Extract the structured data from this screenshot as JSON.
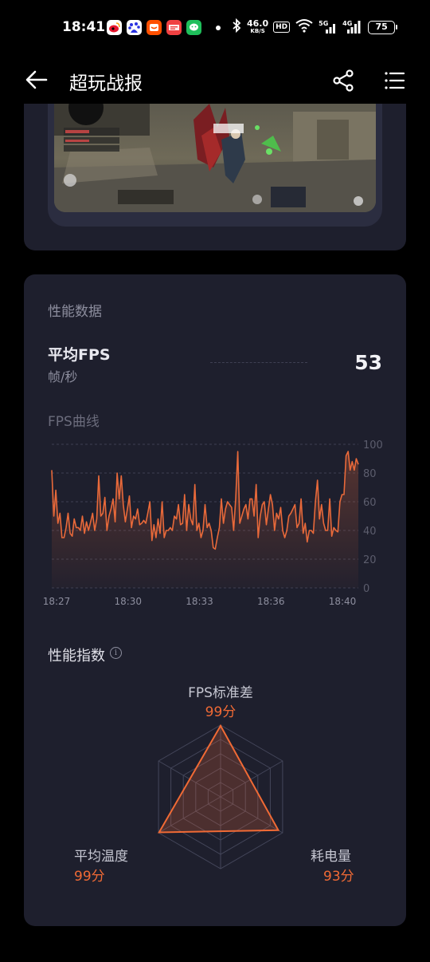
{
  "status_bar": {
    "time": "18:41",
    "net_speed_value": "46.0",
    "net_speed_unit": "KB/S",
    "hd_badge": "HD",
    "signal_1": "5G",
    "signal_2": "4G",
    "battery": "75",
    "icons": [
      "weibo-icon",
      "baidu-icon",
      "taobao-icon",
      "toutiao-icon",
      "wechat-icon",
      "bluetooth-icon",
      "wifi-icon"
    ]
  },
  "header": {
    "title": "超玩战报"
  },
  "performance": {
    "section_title": "性能数据",
    "avg_fps_label": "平均FPS",
    "avg_fps_unit": "帧/秒",
    "avg_fps_value": "53",
    "fps_curve_title": "FPS曲线",
    "index_title": "性能指数",
    "info_glyph": "i"
  },
  "chart_data": {
    "type": "line",
    "title": "FPS曲线",
    "x_tick_labels": [
      "18:27",
      "18:30",
      "18:33",
      "18:36",
      "18:40"
    ],
    "y_tick_labels": [
      "100",
      "80",
      "60",
      "40",
      "20",
      "0"
    ],
    "ylim": [
      0,
      100
    ],
    "grid": true,
    "series_color": "#e8693a",
    "values": [
      82,
      50,
      68,
      45,
      52,
      35,
      35,
      42,
      52,
      38,
      36,
      48,
      42,
      42,
      40,
      50,
      38,
      46,
      40,
      46,
      52,
      40,
      48,
      78,
      50,
      52,
      63,
      40,
      50,
      55,
      62,
      46,
      80,
      62,
      78,
      58,
      46,
      55,
      64,
      42,
      50,
      48,
      55,
      44,
      45,
      47,
      45,
      52,
      60,
      33,
      44,
      35,
      48,
      38,
      60,
      35,
      40,
      40,
      42,
      40,
      50,
      48,
      58,
      44,
      45,
      65,
      40,
      58,
      48,
      44,
      72,
      40,
      45,
      35,
      40,
      58,
      42,
      45,
      40,
      28,
      27,
      35,
      42,
      62,
      45,
      55,
      60,
      58,
      56,
      40,
      62,
      95,
      45,
      50,
      55,
      58,
      48,
      62,
      62,
      50,
      72,
      35,
      50,
      58,
      60,
      44,
      55,
      65,
      58,
      40,
      52,
      48,
      56,
      40,
      35,
      40,
      50,
      52,
      55,
      58,
      42,
      45,
      62,
      38,
      45,
      32,
      40,
      40,
      38,
      60,
      75,
      48,
      58,
      45,
      40,
      40,
      62,
      36,
      42,
      40,
      39,
      60,
      65,
      65,
      92,
      95,
      82,
      88,
      82,
      90,
      86
    ]
  },
  "radar_data": {
    "axes": [
      {
        "label": "FPS标准差",
        "score": "99分",
        "value": 99
      },
      {
        "label": "耗电量",
        "score": "93分",
        "value": 93
      },
      {
        "label": "平均温度",
        "score": "99分",
        "value": 99
      }
    ],
    "line_color": "#f06a35"
  }
}
